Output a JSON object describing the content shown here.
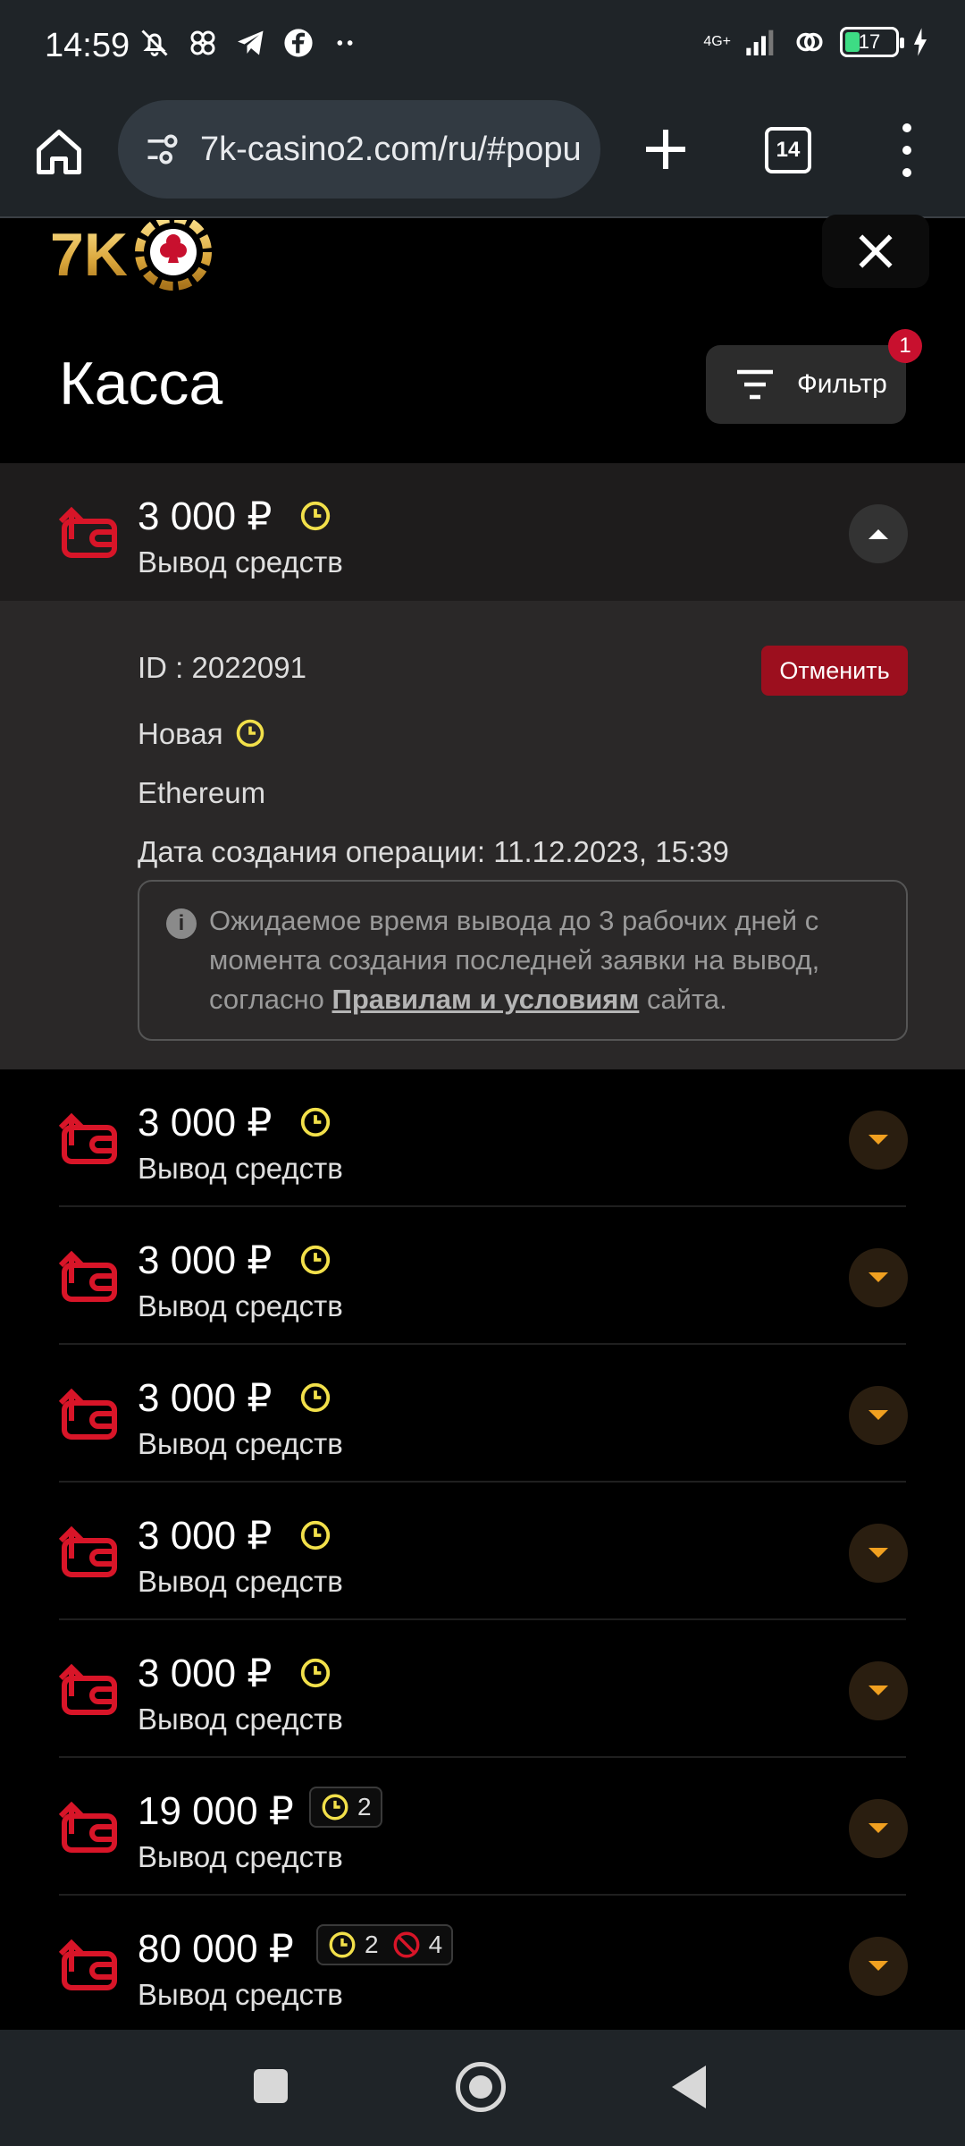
{
  "status_bar": {
    "time": "14:59",
    "network": "4G+",
    "battery_level": "17"
  },
  "browser": {
    "url": "7k-casino2.com/ru/#popu",
    "tab_count": "14"
  },
  "header": {
    "logo_text": "7K",
    "title": "Касса",
    "filter_label": "Фильтр",
    "filter_count": "1"
  },
  "transactions": [
    {
      "amount": "3 000 ₽",
      "type": "Вывод средств"
    },
    {
      "amount": "3 000 ₽",
      "type": "Вывод средств"
    },
    {
      "amount": "3 000 ₽",
      "type": "Вывод средств"
    },
    {
      "amount": "3 000 ₽",
      "type": "Вывод средств"
    },
    {
      "amount": "3 000 ₽",
      "type": "Вывод средств"
    },
    {
      "amount": "3 000 ₽",
      "type": "Вывод средств"
    },
    {
      "amount": "19 000 ₽",
      "type": "Вывод средств",
      "pending_count": "2"
    },
    {
      "amount": "80 000 ₽",
      "type": "Вывод средств",
      "pending_count": "2",
      "rejected_count": "4"
    }
  ],
  "detail": {
    "id_text": "ID : 2022091",
    "cancel_label": "Отменить",
    "status": "Новая",
    "method": "Ethereum",
    "created": "Дата создания операции: 11.12.2023, 15:39",
    "info_before": "Ожидаемое время вывода до 3 рабочих дней с момента создания последней заявки на вывод, согласно ",
    "info_link": "Правилам и условиям",
    "info_after": " сайта."
  },
  "colors": {
    "accent_red": "#c8102e",
    "clock_yellow": "#f2e04a",
    "chevron_gold": "#f0a020"
  }
}
